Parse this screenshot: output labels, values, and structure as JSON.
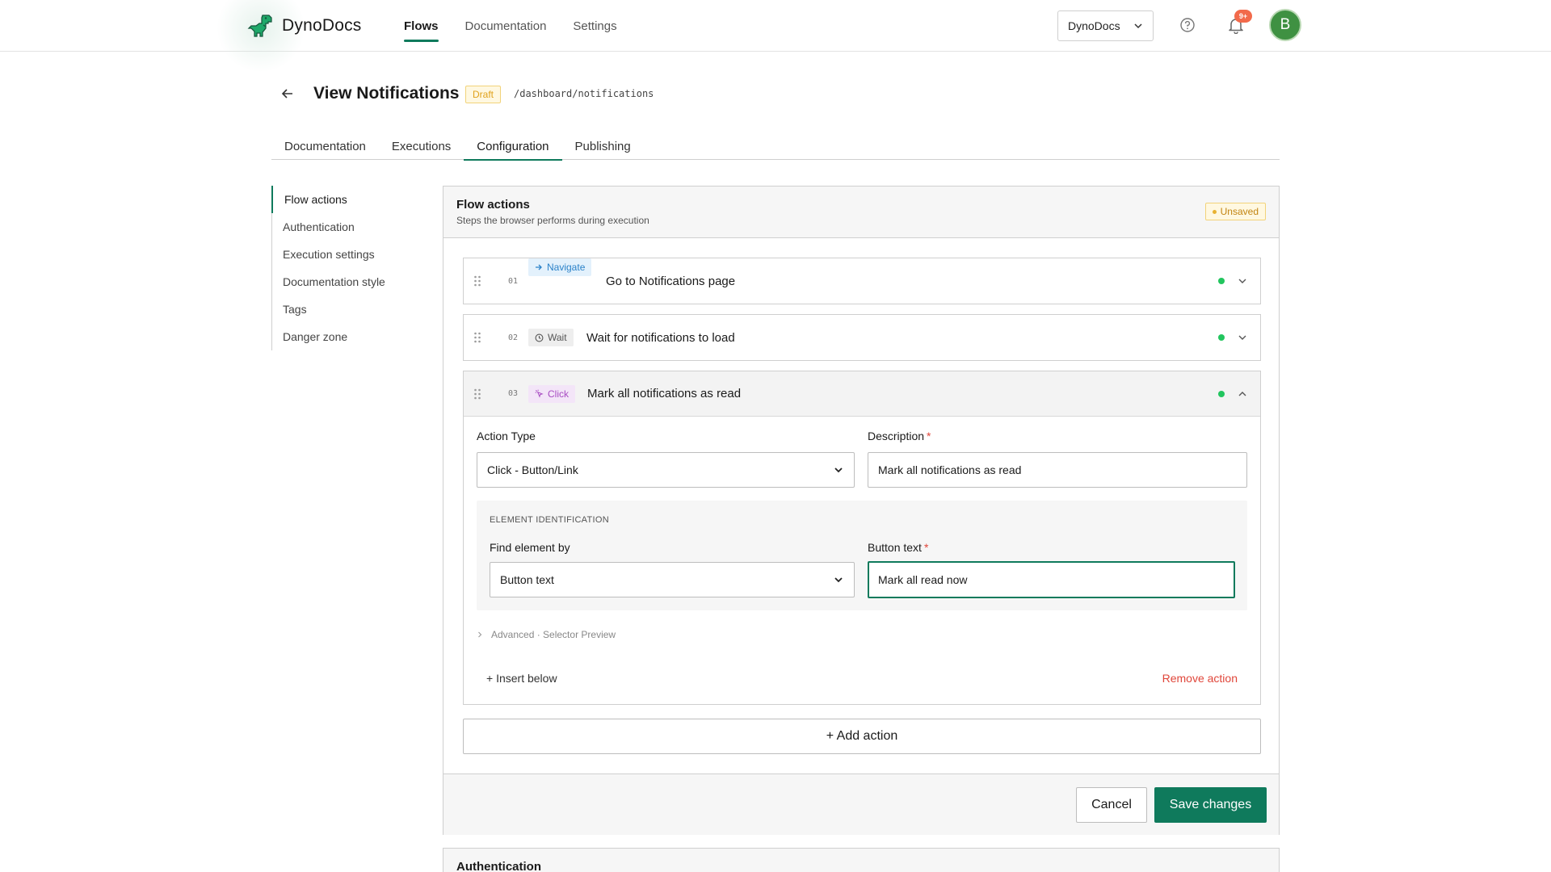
{
  "app": {
    "name": "DynoDocs",
    "nav": [
      "Flows",
      "Documentation",
      "Settings"
    ],
    "active_nav": "Flows",
    "workspace": "DynoDocs",
    "notification_count": "9+",
    "avatar_initial": "B"
  },
  "page": {
    "title": "View Notifications",
    "status": "Draft",
    "route": "/dashboard/notifications",
    "tabs": [
      "Documentation",
      "Executions",
      "Configuration",
      "Publishing"
    ],
    "active_tab": "Configuration"
  },
  "sidebar": {
    "items": [
      "Flow actions",
      "Authentication",
      "Execution settings",
      "Documentation style",
      "Tags",
      "Danger zone"
    ],
    "active": "Flow actions"
  },
  "flow_actions": {
    "title": "Flow actions",
    "subtitle": "Steps the browser performs during execution",
    "unsaved_label": "Unsaved",
    "actions": [
      {
        "number": "01",
        "type": "Navigate",
        "title": "Go to Notifications page",
        "expanded": false
      },
      {
        "number": "02",
        "type": "Wait",
        "title": "Wait for notifications to load",
        "expanded": false
      },
      {
        "number": "03",
        "type": "Click",
        "title": "Mark all notifications as read",
        "expanded": true
      }
    ],
    "editor": {
      "action_type_label": "Action Type",
      "action_type_value": "Click - Button/Link",
      "description_label": "Description",
      "description_value": "Mark all notifications as read",
      "element_section": "ELEMENT IDENTIFICATION",
      "find_by_label": "Find element by",
      "find_by_value": "Button text",
      "button_text_label": "Button text",
      "button_text_value": "Mark all read now",
      "advanced_label": "Advanced · Selector Preview",
      "insert_below": "+ Insert below",
      "remove_action": "Remove action"
    },
    "add_action": "+ Add action",
    "cancel": "Cancel",
    "save": "Save changes"
  },
  "authentication_panel": {
    "title": "Authentication"
  },
  "colors": {
    "accent": "#0f7a5c",
    "status_ok": "#22c55e",
    "danger": "#e0463a",
    "draft": "#e0a21c",
    "badge": "#f26a4b"
  },
  "icons": {
    "logo": "dinosaur-icon",
    "help": "question-circle-icon",
    "notifications": "bell-icon",
    "back": "arrow-left-icon"
  }
}
